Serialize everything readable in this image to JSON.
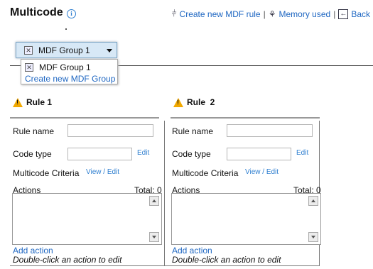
{
  "header": {
    "title": "Multicode",
    "info_glyph": "i",
    "links": {
      "create_rule": "Create new MDF rule",
      "memory_used": "Memory used",
      "back": "Back"
    },
    "separator": "|"
  },
  "group_dropdown": {
    "selected": "MDF Group 1",
    "options": [
      "MDF Group 1"
    ],
    "create_new": "Create new MDF Group"
  },
  "rules": [
    {
      "title": "Rule 1",
      "rule_name_label": "Rule name",
      "rule_name_value": "",
      "code_type_label": "Code type",
      "code_type_value": "",
      "edit_label": "Edit",
      "criteria_label": "Multicode Criteria",
      "view_edit_label": "View / Edit",
      "actions_label": "Actions",
      "total_label": "Total: 0",
      "add_action_label": "Add action",
      "hint": "Double-click an action to edit"
    },
    {
      "title": "Rule  2",
      "rule_name_label": "Rule name",
      "rule_name_value": "",
      "code_type_label": "Code type",
      "code_type_value": "",
      "edit_label": "Edit",
      "criteria_label": "Multicode Criteria",
      "view_edit_label": "View / Edit",
      "actions_label": "Actions",
      "total_label": "Total: 0",
      "add_action_label": "Add action",
      "hint": "Double-click an action to edit"
    }
  ],
  "icons": {
    "info": "info-icon",
    "create_rule": "filter-plus-icon",
    "memory": "memory-chip-icon",
    "back": "back-arrow-icon",
    "warning": "warning-icon",
    "group": "close-box-icon"
  },
  "colors": {
    "link": "#1f67c2",
    "warning": "#f2a900",
    "dropdown_bg": "#d7e8f6"
  }
}
